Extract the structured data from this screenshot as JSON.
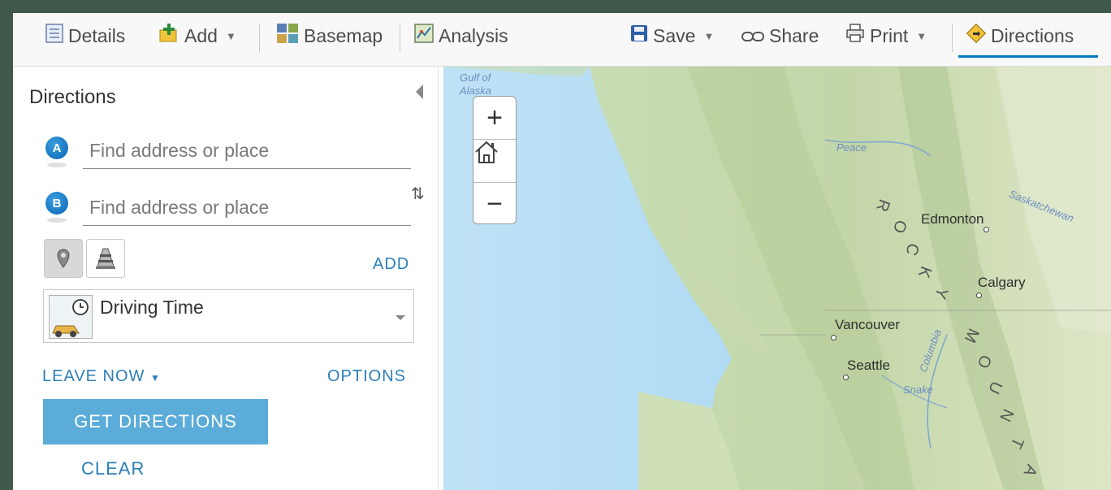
{
  "toolbar": {
    "details": "Details",
    "add": "Add",
    "basemap": "Basemap",
    "analysis": "Analysis",
    "save": "Save",
    "share": "Share",
    "print": "Print",
    "directions": "Directions",
    "active_tab": "Directions",
    "accent_color": "#0079c1"
  },
  "sidebar": {
    "title": "Directions",
    "stop_a": {
      "badge": "A",
      "placeholder": "Find address or place"
    },
    "stop_b": {
      "badge": "B",
      "placeholder": "Find address or place"
    },
    "add_label": "ADD",
    "travel_mode": "Driving Time",
    "leave_now": "LEAVE NOW",
    "options": "OPTIONS",
    "get_directions": "GET DIRECTIONS",
    "clear": "CLEAR",
    "button_color": "#5bacd9",
    "link_color": "#2c7fb8"
  },
  "map": {
    "water_labels": [
      "Gulf of",
      "Alaska"
    ],
    "cities": [
      "Edmonton",
      "Calgary",
      "Vancouver",
      "Seattle"
    ],
    "rivers": [
      "Peace",
      "Saskatchewan",
      "Columbia",
      "Snake"
    ],
    "range_letters": [
      "R",
      "O",
      "C",
      "K",
      "Y",
      "M",
      "O",
      "U",
      "N",
      "T",
      "A"
    ],
    "zoom_in": "+",
    "zoom_out": "−"
  }
}
